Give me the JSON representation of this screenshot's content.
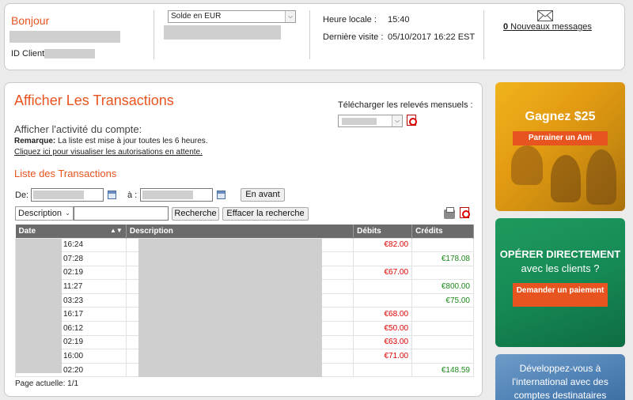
{
  "header": {
    "greeting": "Bonjour",
    "client_id_label": "ID Client",
    "balance_select": "Solde en EUR",
    "local_time_label": "Heure locale :",
    "local_time": "15:40",
    "last_visit_label": "Dernière visite :",
    "last_visit": "05/10/2017 16:22 EST",
    "messages_count": "0",
    "messages_label": " Nouveaux messages"
  },
  "main": {
    "title": "Afficher Les Transactions",
    "download_label": "Télécharger les relevés mensuels :",
    "activity_heading": "Afficher l'activité du compte:",
    "note_bold": "Remarque:",
    "note_text": " La liste est mise à jour toutes les 6 heures.",
    "pending_link": "Cliquez ici pour visualiser les autorisations en attente.",
    "list_heading": "Liste des Transactions",
    "from_label": "De:",
    "to_label": "à :",
    "forward_button": "En avant",
    "filter_select": "Description",
    "search_button": "Recherche",
    "clear_button": "Effacer la recherche",
    "columns": {
      "date": "Date",
      "description": "Description",
      "debits": "Débits",
      "credits": "Crédits"
    },
    "rows": [
      {
        "time": "16:24",
        "debit": "€82.00",
        "credit": ""
      },
      {
        "time": "07:28",
        "debit": "",
        "credit": "€178.08"
      },
      {
        "time": "02:19",
        "debit": "€67.00",
        "credit": ""
      },
      {
        "time": "11:27",
        "debit": "",
        "credit": "€800.00"
      },
      {
        "time": "03:23",
        "debit": "",
        "credit": "€75.00"
      },
      {
        "time": "16:17",
        "debit": "€68.00",
        "credit": ""
      },
      {
        "time": "06:12",
        "debit": "€50.00",
        "credit": ""
      },
      {
        "time": "02:19",
        "debit": "€63.00",
        "credit": ""
      },
      {
        "time": "16:00",
        "debit": "€71.00",
        "credit": ""
      },
      {
        "time": "02:20",
        "debit": "",
        "credit": "€148.59"
      }
    ],
    "page_info": "Page actuelle: 1/1"
  },
  "promos": {
    "p1_title": "Gagnez $25",
    "p1_button": "Parrainer un Ami",
    "p2_line1": "OPÉRER DIRECTEMENT",
    "p2_line2": "avec les clients ?",
    "p2_button": "Demander un paiement",
    "p3_text": "Développez-vous à l'international avec des comptes destinataires"
  },
  "colors": {
    "accent": "#e8541f",
    "debit": "#e00000",
    "credit": "#1c8a1c",
    "table_header": "#6b6b6b"
  }
}
